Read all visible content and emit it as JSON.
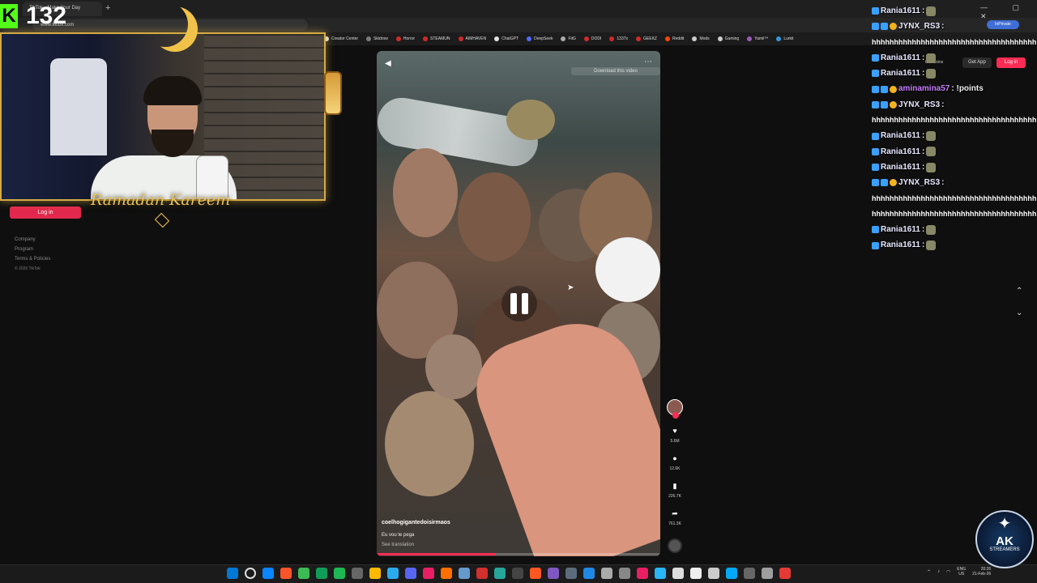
{
  "browser": {
    "tab_title": "TikTok - Make Your Day",
    "new_tab": "+",
    "url": "www.tiktok.com",
    "inprivate": "InPrivate",
    "window_controls": "— ▢ ✕",
    "bookmarks": [
      {
        "label": "Creator Center",
        "color": "#e3e3e3"
      },
      {
        "label": "Skidrow",
        "color": "#7c7c7c"
      },
      {
        "label": "Horror",
        "color": "#d02a2a"
      },
      {
        "label": "STEAMUN",
        "color": "#d02a2a"
      },
      {
        "label": "AIMHAVEN",
        "color": "#d02a2a"
      },
      {
        "label": "ChatGPT",
        "color": "#e3e3e3"
      },
      {
        "label": "DeepSeek",
        "color": "#4d6bfe"
      },
      {
        "label": "FitG",
        "color": "#aaa"
      },
      {
        "label": "DODI",
        "color": "#d02a2a"
      },
      {
        "label": "1337x",
        "color": "#d02a2a"
      },
      {
        "label": "GEEKZ",
        "color": "#d02a2a"
      },
      {
        "label": "Reddit",
        "color": "#ff4500"
      },
      {
        "label": "Mods",
        "color": "#ccc"
      },
      {
        "label": "Gaming",
        "color": "#ccc"
      },
      {
        "label": "Yamil™",
        "color": "#9b59b6"
      },
      {
        "label": "Lurkit",
        "color": "#3498db"
      }
    ]
  },
  "tiktok": {
    "login_left": "Log in",
    "footer": {
      "company": "Company",
      "program": "Program",
      "terms": "Terms & Policies",
      "copyright": "© 2026 TikTok"
    },
    "get_coins": "Get Coins",
    "get_app": "Get App",
    "login_right": "Log in",
    "download": "Download this video",
    "video": {
      "author": "coelhogigantedoisirmaos",
      "caption": "Eu vou te pega",
      "translation": "See translation",
      "progress": 0.42
    },
    "actions": {
      "likes": "5.6M",
      "comments": "12.6K",
      "saves": "226.7K",
      "shares": "761.3K"
    }
  },
  "stream_overlay": {
    "follower_k": "K",
    "follower_count": "132",
    "ramadan_text": "Ramadan Kareem"
  },
  "chat": [
    {
      "type": "msg",
      "badges": [
        "b"
      ],
      "user": "Rania1611",
      "text": ":",
      "emote": true,
      "color": "#e8e8ff"
    },
    {
      "type": "msg",
      "badges": [
        "b",
        "b",
        "y"
      ],
      "user": "JYNX_RS3",
      "text": ":",
      "emote": false,
      "color": "#e8e8ff"
    },
    {
      "type": "spam",
      "text": "hhhhhhhhhhhhhhhhhhhhhhhhhhhhhhhhhhhhhhhhhh"
    },
    {
      "type": "msg",
      "badges": [
        "b"
      ],
      "user": "Rania1611",
      "text": ":",
      "emote": true,
      "color": "#e8e8ff"
    },
    {
      "type": "msg",
      "badges": [
        "b"
      ],
      "user": "Rania1611",
      "text": ":",
      "emote": true,
      "color": "#e8e8ff"
    },
    {
      "type": "msg",
      "badges": [
        "b",
        "b",
        "y"
      ],
      "user": "aminamina57",
      "text": ": !points",
      "emote": false,
      "color": "#c77dff"
    },
    {
      "type": "msg",
      "badges": [
        "b",
        "b",
        "y"
      ],
      "user": "JYNX_RS3",
      "text": ":",
      "emote": false,
      "color": "#e8e8ff"
    },
    {
      "type": "spam",
      "text": "hhhhhhhhhhhhhhhhhhhhhhhhhhhhhhhhhhhhhhhhhh"
    },
    {
      "type": "msg",
      "badges": [
        "b"
      ],
      "user": "Rania1611",
      "text": ":",
      "emote": true,
      "color": "#e8e8ff"
    },
    {
      "type": "msg",
      "badges": [
        "b"
      ],
      "user": "Rania1611",
      "text": ":",
      "emote": true,
      "color": "#e8e8ff"
    },
    {
      "type": "msg",
      "badges": [
        "b"
      ],
      "user": "Rania1611",
      "text": ":",
      "emote": true,
      "color": "#e8e8ff"
    },
    {
      "type": "msg",
      "badges": [
        "b",
        "b",
        "y"
      ],
      "user": "JYNX_RS3",
      "text": ":",
      "emote": false,
      "color": "#e8e8ff"
    },
    {
      "type": "spam",
      "text": "hhhhhhhhhhhhhhhhhhhhhhhhhhhhhhhhhhhhhhhhhh"
    },
    {
      "type": "spam",
      "text": "hhhhhhhhhhhhhhhhhhhhhhhhhhhhhhhhhhhhhhhhhh"
    },
    {
      "type": "msg",
      "badges": [
        "b"
      ],
      "user": "Rania1611",
      "text": ":",
      "emote": true,
      "color": "#e8e8ff"
    },
    {
      "type": "msg",
      "badges": [
        "b"
      ],
      "user": "Rania1611",
      "text": ":",
      "emote": true,
      "color": "#e8e8ff"
    }
  ],
  "taskbar": {
    "icons": [
      "#0078d4",
      "#ddd",
      "#0a84ff",
      "#fb542b",
      "#3cba54",
      "#0f9d58",
      "#1db954",
      "#666",
      "#ffb900",
      "#2aabee",
      "#5865f2",
      "#e91e63",
      "#ff6f00",
      "#69c",
      "#d32f2f",
      "#26a69a",
      "#444",
      "#ff5722",
      "#7e57c2",
      "#5b6b7b",
      "#1e88e5",
      "#aaa",
      "#888",
      "#e91e63",
      "#29b6f6",
      "#ddd",
      "#eee",
      "#ccc",
      "#03a9f4",
      "#666",
      "#9e9e9e",
      "#e53935"
    ],
    "lang_top": "ENG",
    "lang_bottom": "US",
    "time": "20:26",
    "date": "21-Feb-26"
  },
  "ak_logo": {
    "text": "AK",
    "sub": "STREAMERS"
  }
}
